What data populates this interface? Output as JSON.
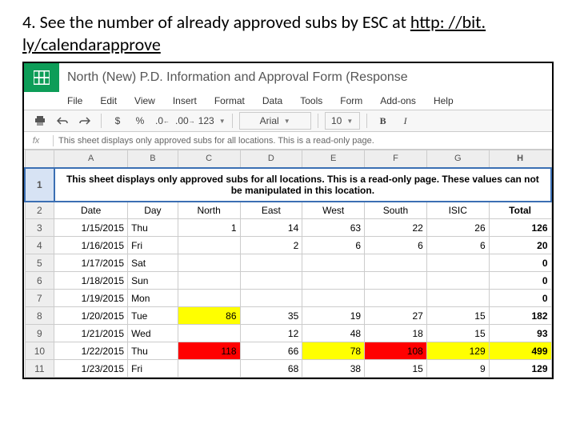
{
  "instruction": {
    "prefix": "4. See the number of already approved subs by ESC at ",
    "link_text": "http: //bit. ly/calendarapprove"
  },
  "header": {
    "doc_title": "North (New) P.D. Information and Approval Form (Response"
  },
  "menubar": [
    "File",
    "Edit",
    "View",
    "Insert",
    "Format",
    "Data",
    "Tools",
    "Form",
    "Add-ons",
    "Help"
  ],
  "toolbar": {
    "currency": "$",
    "percent": "%",
    "dec_dec": ".0",
    "dec_inc": ".00",
    "numfmt": "123",
    "font": "Arial",
    "size": "10",
    "bold": "B",
    "italic": "I"
  },
  "fx_text": "This sheet displays only approved subs for all locations.  This is a read-only page.",
  "columns": [
    "A",
    "B",
    "C",
    "D",
    "E",
    "F",
    "G",
    "H"
  ],
  "banner": "This sheet displays only approved subs for all locations.  This is a read-only page.  These values can not be manipulated in this location.",
  "header_row": [
    "Date",
    "Day",
    "North",
    "East",
    "West",
    "South",
    "ISIC",
    "Total"
  ],
  "rows": [
    {
      "n": "2",
      "date": "",
      "day": "",
      "c": [
        "",
        "",
        "",
        "",
        "",
        ""
      ]
    },
    {
      "n": "3",
      "date": "1/15/2015",
      "day": "Thu",
      "c": [
        "1",
        "14",
        "63",
        "22",
        "26",
        "126"
      ]
    },
    {
      "n": "4",
      "date": "1/16/2015",
      "day": "Fri",
      "c": [
        "",
        "2",
        "6",
        "6",
        "6",
        "20"
      ]
    },
    {
      "n": "5",
      "date": "1/17/2015",
      "day": "Sat",
      "c": [
        "",
        "",
        "",
        "",
        "",
        "0"
      ]
    },
    {
      "n": "6",
      "date": "1/18/2015",
      "day": "Sun",
      "c": [
        "",
        "",
        "",
        "",
        "",
        "0"
      ]
    },
    {
      "n": "7",
      "date": "1/19/2015",
      "day": "Mon",
      "c": [
        "",
        "",
        "",
        "",
        "",
        "0"
      ]
    },
    {
      "n": "8",
      "date": "1/20/2015",
      "day": "Tue",
      "c": [
        "86",
        "35",
        "19",
        "27",
        "15",
        "182"
      ],
      "hl": {
        "0": "yellow"
      }
    },
    {
      "n": "9",
      "date": "1/21/2015",
      "day": "Wed",
      "c": [
        "",
        "12",
        "48",
        "18",
        "15",
        "93"
      ]
    },
    {
      "n": "10",
      "date": "1/22/2015",
      "day": "Thu",
      "c": [
        "118",
        "66",
        "78",
        "108",
        "129",
        "499"
      ],
      "hl": {
        "0": "red",
        "2": "yellow",
        "3": "red",
        "4": "yellow",
        "5": "yellow"
      }
    },
    {
      "n": "11",
      "date": "1/23/2015",
      "day": "Fri",
      "c": [
        "",
        "68",
        "38",
        "15",
        "9",
        "129"
      ]
    }
  ]
}
